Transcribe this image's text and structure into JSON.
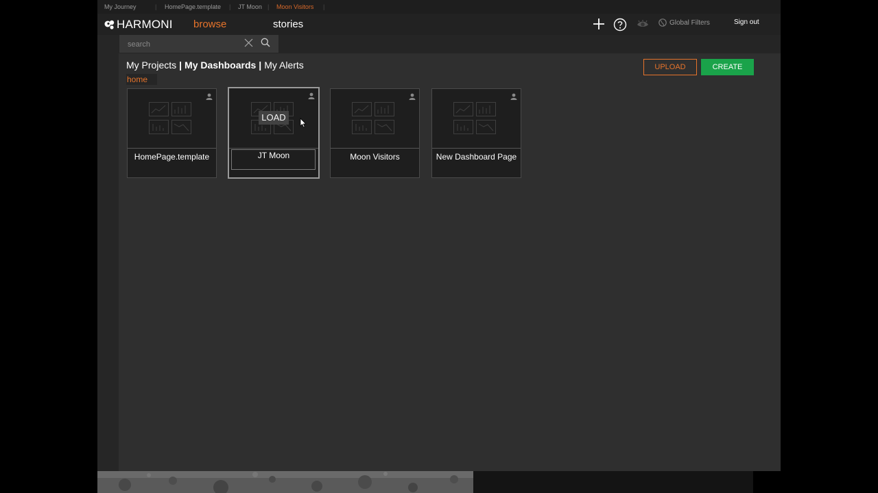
{
  "journey": {
    "label": "My Journey",
    "crumbs": [
      "HomePage.template",
      "JT Moon",
      "Moon Visitors"
    ]
  },
  "topbar": {
    "logo": "HARMONI",
    "nav_browse": "browse",
    "nav_stories": "stories",
    "global_filters": "Global Filters",
    "sign_out": "Sign out"
  },
  "search": {
    "placeholder": "search",
    "value": ""
  },
  "tabs": {
    "projects": "My Projects",
    "dashboards": "My Dashboards",
    "alerts": "My Alerts",
    "separator": "|"
  },
  "breadcrumb_home": "home",
  "actions": {
    "upload": "UPLOAD",
    "create": "CREATE"
  },
  "cards": [
    {
      "title": "HomePage.template"
    },
    {
      "title": "JT Moon",
      "overlay": "LOAD"
    },
    {
      "title": "Moon Visitors"
    },
    {
      "title": "New Dashboard Page"
    }
  ],
  "colors": {
    "accent": "#e7742b",
    "create": "#1aa34a",
    "panel": "#2f2f2f"
  }
}
